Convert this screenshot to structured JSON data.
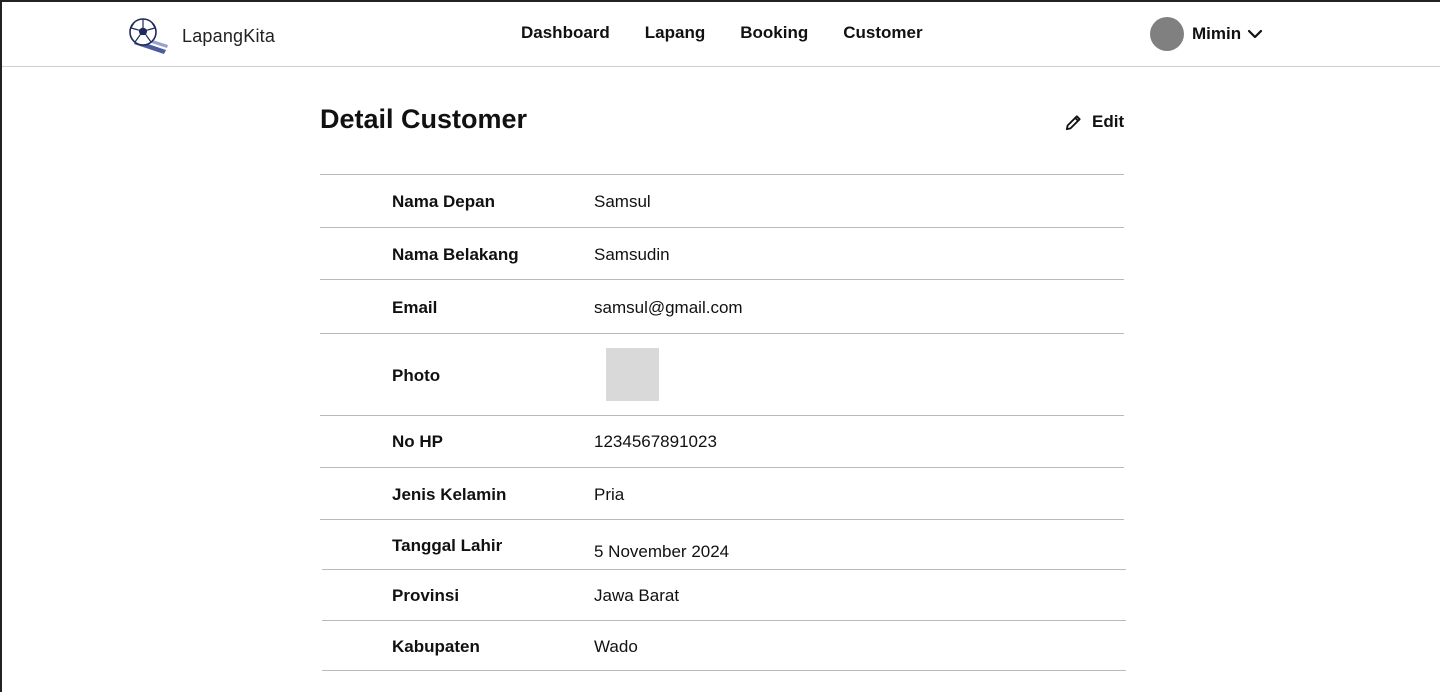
{
  "header": {
    "brand": "LapangKita",
    "nav": [
      "Dashboard",
      "Lapang",
      "Booking",
      "Customer"
    ],
    "user_name": "Mimin"
  },
  "page": {
    "title": "Detail Customer",
    "edit_label": "Edit"
  },
  "details": [
    {
      "label": "Nama Depan",
      "value": "Samsul"
    },
    {
      "label": "Nama Belakang",
      "value": "Samsudin"
    },
    {
      "label": "Email",
      "value": "samsul@gmail.com"
    },
    {
      "label": "Photo",
      "value": ""
    },
    {
      "label": "No HP",
      "value": "1234567891023"
    },
    {
      "label": "Jenis Kelamin",
      "value": "Pria"
    },
    {
      "label": "Tanggal Lahir",
      "value": "5 November 2024"
    },
    {
      "label": "Provinsi",
      "value": "Jawa Barat"
    },
    {
      "label": "Kabupaten",
      "value": "Wado"
    }
  ],
  "colors": {
    "avatar": "#808080",
    "divider": "#b9b9b9",
    "photo_placeholder": "#d9d9d9",
    "logo_blue": "#2c3e8c"
  },
  "icons": {
    "logo": "soccer-ball-logo-icon",
    "user_menu": "chevron-down-icon",
    "edit": "pencil-icon"
  }
}
